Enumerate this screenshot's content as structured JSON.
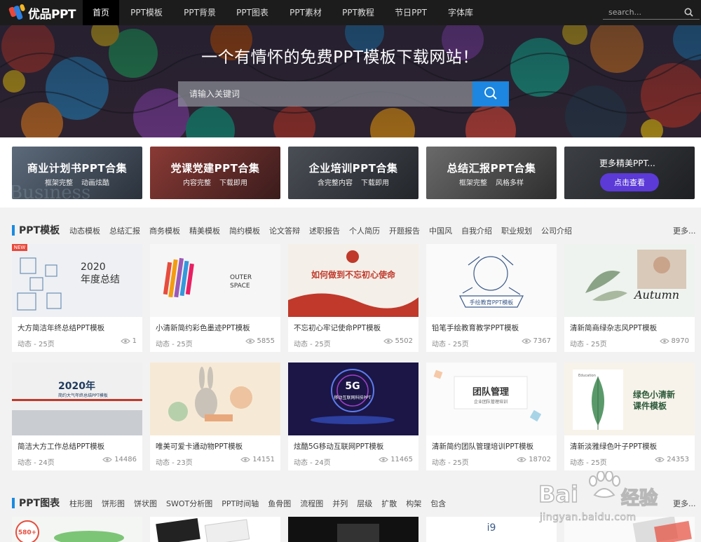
{
  "nav": {
    "logo_text": "优品PPT",
    "items": [
      "首页",
      "PPT模板",
      "PPT背景",
      "PPT图表",
      "PPT素材",
      "PPT教程",
      "节日PPT",
      "字体库"
    ],
    "active_index": 0,
    "search_placeholder": "search..."
  },
  "hero": {
    "title": "一个有情怀的免费PPT模板下载网站！",
    "search_placeholder": "请输入关键词"
  },
  "cards": [
    {
      "title": "商业计划书PPT合集",
      "tags": [
        "框架完整",
        "动画炫酷"
      ]
    },
    {
      "title": "党课党建PPT合集",
      "tags": [
        "内容完整",
        "下载即用"
      ]
    },
    {
      "title": "企业培训PPT合集",
      "tags": [
        "含完整内容",
        "下载即用"
      ]
    },
    {
      "title": "总结汇报PPT合集",
      "tags": [
        "框架完整",
        "风格多样"
      ]
    }
  ],
  "more_card": {
    "title": "更多精美PPT...",
    "button": "点击查看"
  },
  "templates_section": {
    "title": "PPT模板",
    "tags": [
      "动态模板",
      "总结汇报",
      "商务模板",
      "精美模板",
      "简约模板",
      "论文答辩",
      "述职报告",
      "个人简历",
      "开题报告",
      "中国风",
      "自我介绍",
      "职业规划",
      "公司介绍"
    ],
    "more": "更多..."
  },
  "templates": [
    {
      "name": "大方简洁年终总结PPT模板",
      "meta": "动态 - 25页",
      "views": "1",
      "badge": "NEW",
      "thumb_text": [
        "2020",
        "年度总结"
      ]
    },
    {
      "name": "小清新简约彩色墨迹PPT模板",
      "meta": "动态 - 25页",
      "views": "5855",
      "thumb_text": [
        "OUTER",
        "SPACE"
      ]
    },
    {
      "name": "不忘初心牢记使命PPT模板",
      "meta": "动态 - 25页",
      "views": "5502",
      "thumb_text": [
        "如何做到不忘初心使命"
      ]
    },
    {
      "name": "铅笔手绘教育教学PPT模板",
      "meta": "动态 - 25页",
      "views": "7367",
      "thumb_text": [
        "手绘教育PPT模板"
      ]
    },
    {
      "name": "清新简商绿杂志风PPT模板",
      "meta": "动态 - 25页",
      "views": "8970",
      "thumb_text": [
        "Autumn"
      ]
    },
    {
      "name": "简洁大方工作总结PPT模板",
      "meta": "动态 - 24页",
      "views": "14486",
      "thumb_text": [
        "2020年",
        "简约大气年终总结PPT模板"
      ]
    },
    {
      "name": "唯美可爱卡通动物PPT模板",
      "meta": "动态 - 23页",
      "views": "14151",
      "thumb_text": []
    },
    {
      "name": "炫酷5G移动互联网PPT模板",
      "meta": "动态 - 24页",
      "views": "11465",
      "thumb_text": [
        "5G",
        "移动互联网科技PPT"
      ]
    },
    {
      "name": "清新简约团队管理培训PPT模板",
      "meta": "动态 - 25页",
      "views": "18702",
      "thumb_text": [
        "团队管理",
        "企业团队管理培训"
      ]
    },
    {
      "name": "清新淡雅绿色叶子PPT模板",
      "meta": "动态 - 25页",
      "views": "24353",
      "thumb_text": [
        "绿色小清新",
        "课件模板",
        "Education"
      ]
    }
  ],
  "charts_section": {
    "title": "PPT图表",
    "tags": [
      "柱形图",
      "饼形图",
      "饼状图",
      "SWOT分析图",
      "PPT时间轴",
      "鱼骨图",
      "流程图",
      "并列",
      "层级",
      "扩散",
      "构架",
      "包含"
    ],
    "more": "更多..."
  },
  "chart_thumbs": [
    {
      "text": "580+"
    },
    {
      "text": ""
    },
    {
      "text": ""
    },
    {
      "text": "i9"
    },
    {
      "text": ""
    }
  ],
  "watermark": {
    "logo": "Bai",
    "brand": "经验",
    "url": "jingyan.baidu.com"
  }
}
